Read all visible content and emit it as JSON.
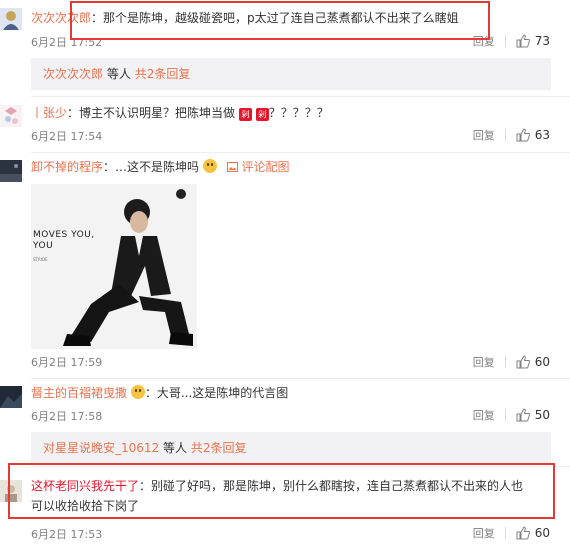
{
  "comments": [
    {
      "user": "次次次次郎",
      "text": "：那个是陈坤，越级碰瓷吧，p太过了连自己蒸煮都认不出来了么瞎姐",
      "time": "6月2日 17:52",
      "reply_label": "回复",
      "likes": "73",
      "replies_strip": {
        "user": "次次次次郎",
        "suffix": "等人",
        "count": "共2条回复"
      }
    },
    {
      "user": "丨张少",
      "text": "：博主不认识明星？把陈坤当做",
      "badges": [
        "剁",
        "剁"
      ],
      "text_tail": "？？？？？",
      "time": "6月2日 17:54",
      "reply_label": "回复",
      "likes": "63"
    },
    {
      "user": "卸不掉的程序",
      "text": "：…这不是陈坤吗",
      "image_link": "评论配图",
      "image_text": [
        "MOVES YOU,",
        "YOU"
      ],
      "image_text_small": "STRIDE",
      "time": "6月2日 17:59",
      "reply_label": "回复",
      "likes": "60"
    },
    {
      "user": "督主的百褶裙曳撒",
      "text": "：大哥...这是陈坤的代言图",
      "time": "6月2日 17:58",
      "reply_label": "回复",
      "likes": "50",
      "replies_strip": {
        "user": "对星星说晚安_10612",
        "suffix": "等人",
        "count": "共2条回复"
      }
    },
    {
      "user": "这杯老同兴我先干了",
      "text": "：别碰了好吗，那是陈坤，别什么都瞎按，连自己蒸煮都认不出来的人也可以收拾收拾下岗了",
      "time": "6月2日 17:53",
      "reply_label": "回复",
      "likes": "60"
    }
  ],
  "colors": {
    "username": "#eb7350",
    "highlight_box": "#e53935",
    "strip_bg": "#f2f2f5"
  }
}
